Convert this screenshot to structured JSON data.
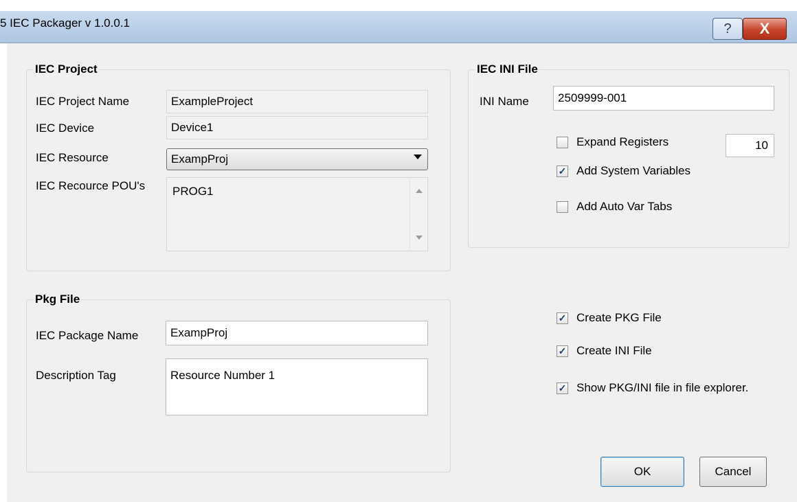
{
  "window": {
    "title": "5 IEC Packager v 1.0.0.1"
  },
  "iec_project": {
    "title": "IEC Project",
    "project_name_label": "IEC Project Name",
    "project_name_value": "ExampleProject",
    "device_label": "IEC Device",
    "device_value": "Device1",
    "resource_label": "IEC Resource",
    "resource_value": "ExampProj",
    "pous_label": "IEC Recource POU's",
    "pous": [
      "PROG1"
    ]
  },
  "iec_ini_file": {
    "title": "IEC INI File",
    "ini_name_label": "INI Name",
    "ini_name_value": "2509999-001",
    "expand_registers": {
      "label": "Expand Registers",
      "checked": false,
      "count": "10"
    },
    "add_system_variables": {
      "label": "Add System Variables",
      "checked": true
    },
    "add_auto_var_tabs": {
      "label": "Add Auto Var Tabs",
      "checked": false
    }
  },
  "pkg_file": {
    "title": "Pkg File",
    "package_name_label": "IEC Package Name",
    "package_name_value": "ExampProj",
    "description_label": "Description Tag",
    "description_value": "Resource Number 1"
  },
  "options": {
    "create_pkg": {
      "label": "Create PKG File",
      "checked": true
    },
    "create_ini": {
      "label": "Create INI File",
      "checked": true
    },
    "show_in_explorer": {
      "label": "Show PKG/INI file in file explorer.",
      "checked": true
    }
  },
  "buttons": {
    "ok": "OK",
    "cancel": "Cancel",
    "help": "?",
    "close": "X"
  },
  "glyphs": {
    "check": "✓"
  }
}
